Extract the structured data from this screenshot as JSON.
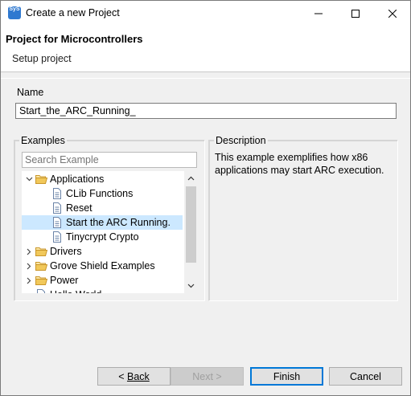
{
  "window": {
    "title": "Create a new Project",
    "icon_label": "SyS"
  },
  "banner": {
    "title": "Project for Microcontrollers",
    "subtitle": "Setup project"
  },
  "name": {
    "label": "Name",
    "value": "Start_the_ARC_Running_"
  },
  "examples": {
    "label": "Examples",
    "search_placeholder": "Search Example",
    "tree": [
      {
        "label": "Applications",
        "type": "folder",
        "expanded": true,
        "level": 0
      },
      {
        "label": "CLib Functions",
        "type": "file",
        "level": 1
      },
      {
        "label": "Reset",
        "type": "file",
        "level": 1
      },
      {
        "label": "Start the ARC Running.",
        "type": "file",
        "level": 1,
        "selected": true
      },
      {
        "label": "Tinycrypt Crypto",
        "type": "file",
        "level": 1
      },
      {
        "label": "Drivers",
        "type": "folder",
        "expanded": false,
        "level": 0
      },
      {
        "label": "Grove Shield Examples",
        "type": "folder",
        "expanded": false,
        "level": 0
      },
      {
        "label": "Power",
        "type": "folder",
        "expanded": false,
        "level": 0
      },
      {
        "label": "Hello World",
        "type": "file",
        "level": 0
      }
    ]
  },
  "description": {
    "label": "Description",
    "text": "This example exemplifies how x86 applications may start ARC execution."
  },
  "buttons": {
    "back": "Back",
    "next": "Next >",
    "finish": "Finish",
    "cancel": "Cancel"
  },
  "colors": {
    "selection": "#cce8ff",
    "accent": "#0078d7",
    "folder": "#e8b83d"
  }
}
